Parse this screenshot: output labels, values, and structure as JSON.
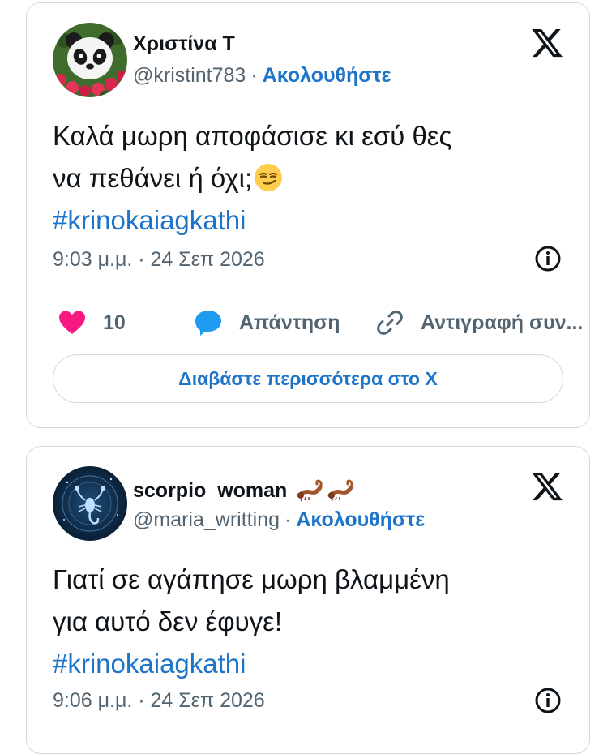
{
  "colors": {
    "text": "#0f1419",
    "secondary": "#536471",
    "link": "#1d74c9",
    "like": "#f91880",
    "reply": "#1d9bf0",
    "border": "#cfd9de"
  },
  "tweets": [
    {
      "author": {
        "name": "Χριστίνα Τ",
        "handle": "@kristint783",
        "separator": "·",
        "follow_label": "Ακολουθήστε",
        "avatar_icon": "panda-avatar"
      },
      "text_line1": "Καλά μωρη αποφάσισε κι εσύ θες",
      "text_line2": "να πεθάνει ή όχι;",
      "text_emoji": "smirking-face-emoji",
      "hashtag": "#krinokaiagkathi",
      "timestamp": "9:03 μ.μ. · 24 Σεπ 2026",
      "actions": {
        "like_count": "10",
        "reply_label": "Απάντηση",
        "copy_label": "Αντιγραφή συν..."
      },
      "read_more_label": "Διαβάστε περισσότερα στο X"
    },
    {
      "author": {
        "name": "scorpio_woman",
        "name_emoji": "scorpion-emoji",
        "handle": "@maria_writting",
        "separator": "·",
        "follow_label": "Ακολουθήστε",
        "avatar_icon": "scorpio-zodiac-avatar"
      },
      "text_line1": "Γιατί σε αγάπησε μωρη βλαμμένη",
      "text_line2": "για αυτό δεν έφυγε!",
      "hashtag": "#krinokaiagkathi",
      "timestamp": "9:06 μ.μ. · 24 Σεπ 2026"
    }
  ]
}
